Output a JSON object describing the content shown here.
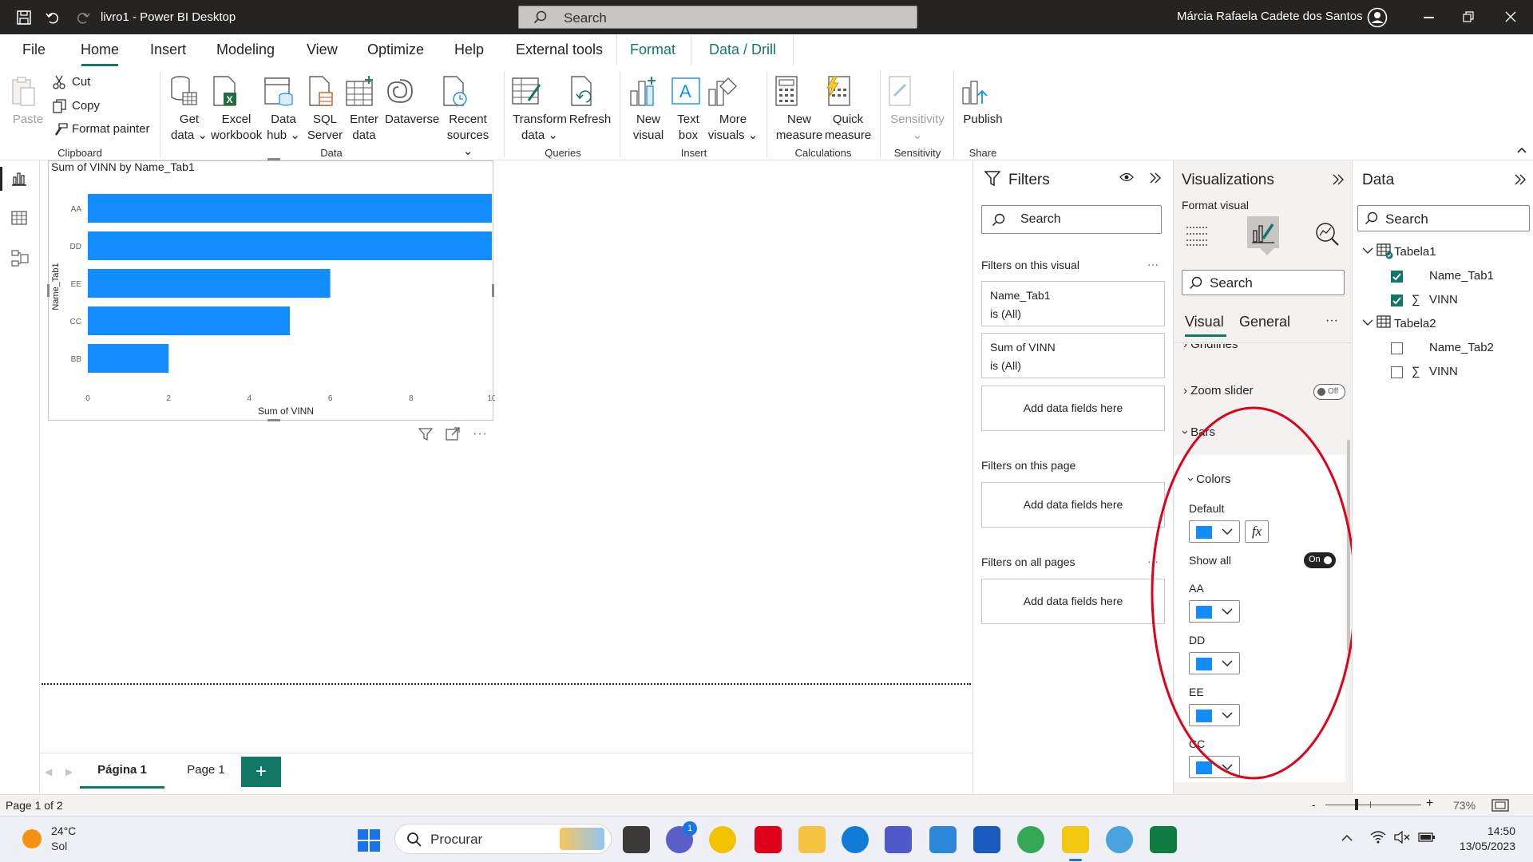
{
  "window": {
    "title": "livro1 - Power BI Desktop",
    "search_placeholder": "Search",
    "user": "Márcia Rafaela Cadete dos Santos"
  },
  "menu_tabs": [
    "File",
    "Home",
    "Insert",
    "Modeling",
    "View",
    "Optimize",
    "Help",
    "External tools",
    "Format",
    "Data / Drill"
  ],
  "ribbon": {
    "clipboard": {
      "paste": "Paste",
      "cut": "Cut",
      "copy": "Copy",
      "format_painter": "Format painter",
      "group": "Clipboard"
    },
    "data": {
      "get_data_1": "Get",
      "get_data_2": "data",
      "excel_1": "Excel",
      "excel_2": "workbook",
      "hub_1": "Data",
      "hub_2": "hub",
      "sql_1": "SQL",
      "sql_2": "Server",
      "enter_1": "Enter",
      "enter_2": "data",
      "dataverse": "Dataverse",
      "recent_1": "Recent",
      "recent_2": "sources",
      "group": "Data"
    },
    "queries": {
      "transform_1": "Transform",
      "transform_2": "data",
      "refresh": "Refresh",
      "group": "Queries"
    },
    "insert": {
      "new_visual_1": "New",
      "new_visual_2": "visual",
      "text_box_1": "Text",
      "text_box_2": "box",
      "more_1": "More",
      "more_2": "visuals",
      "group": "Insert"
    },
    "calculations": {
      "new_measure_1": "New",
      "new_measure_2": "measure",
      "quick_1": "Quick",
      "quick_2": "measure",
      "group": "Calculations"
    },
    "sensitivity": {
      "label": "Sensitivity",
      "group": "Sensitivity"
    },
    "share": {
      "publish": "Publish",
      "group": "Share"
    }
  },
  "visual": {
    "title": "Sum of VINN by Name_Tab1",
    "ylabel": "Name_Tab1",
    "xlabel": "Sum of VINN"
  },
  "chart_data": {
    "type": "bar",
    "orientation": "horizontal",
    "title": "Sum of VINN by Name_Tab1",
    "xlabel": "Sum of VINN",
    "ylabel": "Name_Tab1",
    "categories": [
      "AA",
      "DD",
      "EE",
      "CC",
      "BB"
    ],
    "values": [
      10,
      10,
      6,
      5,
      2
    ],
    "xlim": [
      0,
      10
    ],
    "xticks": [
      "0",
      "2",
      "4",
      "6",
      "8",
      "10"
    ],
    "bar_color": "#118DFF",
    "grid": false
  },
  "filters": {
    "title": "Filters",
    "search": "Search",
    "on_visual": "Filters on this visual",
    "card1_field": "Name_Tab1",
    "card1_state": "is (All)",
    "card2_field": "Sum of VINN",
    "card2_state": "is (All)",
    "add_fields": "Add data fields here",
    "on_page": "Filters on this page",
    "on_all": "Filters on all pages"
  },
  "visualizations": {
    "title": "Visualizations",
    "subtitle": "Format visual",
    "search": "Search",
    "tab_visual": "Visual",
    "tab_general": "General",
    "gridlines": "Gridlines",
    "zoom_slider": "Zoom slider",
    "zoom_state": "Off",
    "bars": "Bars",
    "colors": "Colors",
    "default": "Default",
    "show_all": "Show all",
    "show_all_state": "On",
    "color_items": [
      "AA",
      "DD",
      "EE",
      "CC"
    ],
    "accent": "#118DFF",
    "annotation_color": "#E0001A"
  },
  "data_pane": {
    "title": "Data",
    "search": "Search",
    "table1": "Tabela1",
    "t1_field1": "Name_Tab1",
    "t1_field2": "VINN",
    "table2": "Tabela2",
    "t2_field1": "Name_Tab2",
    "t2_field2": "VINN"
  },
  "pages": [
    "Página 1",
    "Page 1"
  ],
  "status": {
    "page": "Page 1 of 2",
    "zoom": "73%"
  },
  "taskbar": {
    "temp": "24°C",
    "weather": "Sol",
    "search": "Procurar",
    "time": "14:50",
    "date": "13/05/2023",
    "chat_badge": "1"
  }
}
